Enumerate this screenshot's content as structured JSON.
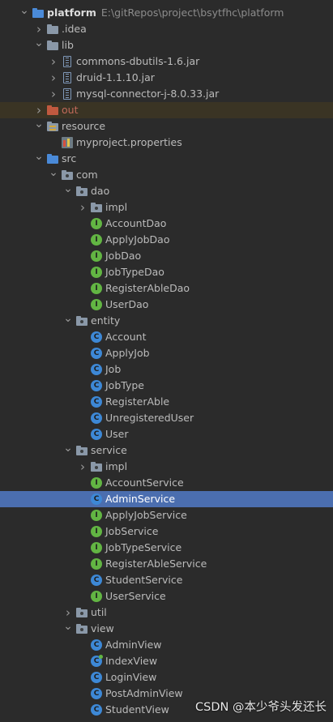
{
  "tree": [
    {
      "depth": 0,
      "arrow": "open",
      "icon": "folder-blue",
      "label": "platform",
      "path": "E:\\gitRepos\\project\\bsytfhc\\platform",
      "bold": true
    },
    {
      "depth": 1,
      "arrow": "closed",
      "icon": "folder",
      "label": ".idea"
    },
    {
      "depth": 1,
      "arrow": "open",
      "icon": "folder",
      "label": "lib"
    },
    {
      "depth": 2,
      "arrow": "closed",
      "icon": "jar",
      "label": "commons-dbutils-1.6.jar"
    },
    {
      "depth": 2,
      "arrow": "closed",
      "icon": "jar",
      "label": "druid-1.1.10.jar"
    },
    {
      "depth": 2,
      "arrow": "closed",
      "icon": "jar",
      "label": "mysql-connector-j-8.0.33.jar"
    },
    {
      "depth": 1,
      "arrow": "closed",
      "icon": "folder-orange",
      "label": "out",
      "style": "out"
    },
    {
      "depth": 1,
      "arrow": "open",
      "icon": "folder-res",
      "label": "resource"
    },
    {
      "depth": 2,
      "arrow": "",
      "icon": "props",
      "label": "myproject.properties"
    },
    {
      "depth": 1,
      "arrow": "open",
      "icon": "folder-blue",
      "label": "src"
    },
    {
      "depth": 2,
      "arrow": "open",
      "icon": "folder-pkg",
      "label": "com"
    },
    {
      "depth": 3,
      "arrow": "open",
      "icon": "folder-pkg",
      "label": "dao"
    },
    {
      "depth": 4,
      "arrow": "closed",
      "icon": "folder-pkg",
      "label": "impl"
    },
    {
      "depth": 4,
      "arrow": "",
      "icon": "interface",
      "label": "AccountDao"
    },
    {
      "depth": 4,
      "arrow": "",
      "icon": "interface",
      "label": "ApplyJobDao"
    },
    {
      "depth": 4,
      "arrow": "",
      "icon": "interface",
      "label": "JobDao"
    },
    {
      "depth": 4,
      "arrow": "",
      "icon": "interface",
      "label": "JobTypeDao"
    },
    {
      "depth": 4,
      "arrow": "",
      "icon": "interface",
      "label": "RegisterAbleDao"
    },
    {
      "depth": 4,
      "arrow": "",
      "icon": "interface",
      "label": "UserDao"
    },
    {
      "depth": 3,
      "arrow": "open",
      "icon": "folder-pkg",
      "label": "entity"
    },
    {
      "depth": 4,
      "arrow": "",
      "icon": "class",
      "label": "Account"
    },
    {
      "depth": 4,
      "arrow": "",
      "icon": "class",
      "label": "ApplyJob"
    },
    {
      "depth": 4,
      "arrow": "",
      "icon": "class",
      "label": "Job"
    },
    {
      "depth": 4,
      "arrow": "",
      "icon": "class",
      "label": "JobType"
    },
    {
      "depth": 4,
      "arrow": "",
      "icon": "class",
      "label": "RegisterAble"
    },
    {
      "depth": 4,
      "arrow": "",
      "icon": "class",
      "label": "UnregisteredUser"
    },
    {
      "depth": 4,
      "arrow": "",
      "icon": "class",
      "label": "User"
    },
    {
      "depth": 3,
      "arrow": "open",
      "icon": "folder-pkg",
      "label": "service"
    },
    {
      "depth": 4,
      "arrow": "closed",
      "icon": "folder-pkg",
      "label": "impl"
    },
    {
      "depth": 4,
      "arrow": "",
      "icon": "interface",
      "label": "AccountService"
    },
    {
      "depth": 4,
      "arrow": "",
      "icon": "class",
      "label": "AdminService",
      "style": "selected"
    },
    {
      "depth": 4,
      "arrow": "",
      "icon": "interface",
      "label": "ApplyJobService"
    },
    {
      "depth": 4,
      "arrow": "",
      "icon": "interface",
      "label": "JobService"
    },
    {
      "depth": 4,
      "arrow": "",
      "icon": "interface",
      "label": "JobTypeService"
    },
    {
      "depth": 4,
      "arrow": "",
      "icon": "interface",
      "label": "RegisterAbleService"
    },
    {
      "depth": 4,
      "arrow": "",
      "icon": "class",
      "label": "StudentService"
    },
    {
      "depth": 4,
      "arrow": "",
      "icon": "interface",
      "label": "UserService"
    },
    {
      "depth": 3,
      "arrow": "closed",
      "icon": "folder-pkg",
      "label": "util"
    },
    {
      "depth": 3,
      "arrow": "open",
      "icon": "folder-pkg",
      "label": "view"
    },
    {
      "depth": 4,
      "arrow": "",
      "icon": "class",
      "label": "AdminView"
    },
    {
      "depth": 4,
      "arrow": "",
      "icon": "class-main",
      "label": "IndexView"
    },
    {
      "depth": 4,
      "arrow": "",
      "icon": "class",
      "label": "LoginView"
    },
    {
      "depth": 4,
      "arrow": "",
      "icon": "class",
      "label": "PostAdminView"
    },
    {
      "depth": 4,
      "arrow": "",
      "icon": "class",
      "label": "StudentView"
    }
  ],
  "watermark": "CSDN @本少爷头发还长"
}
